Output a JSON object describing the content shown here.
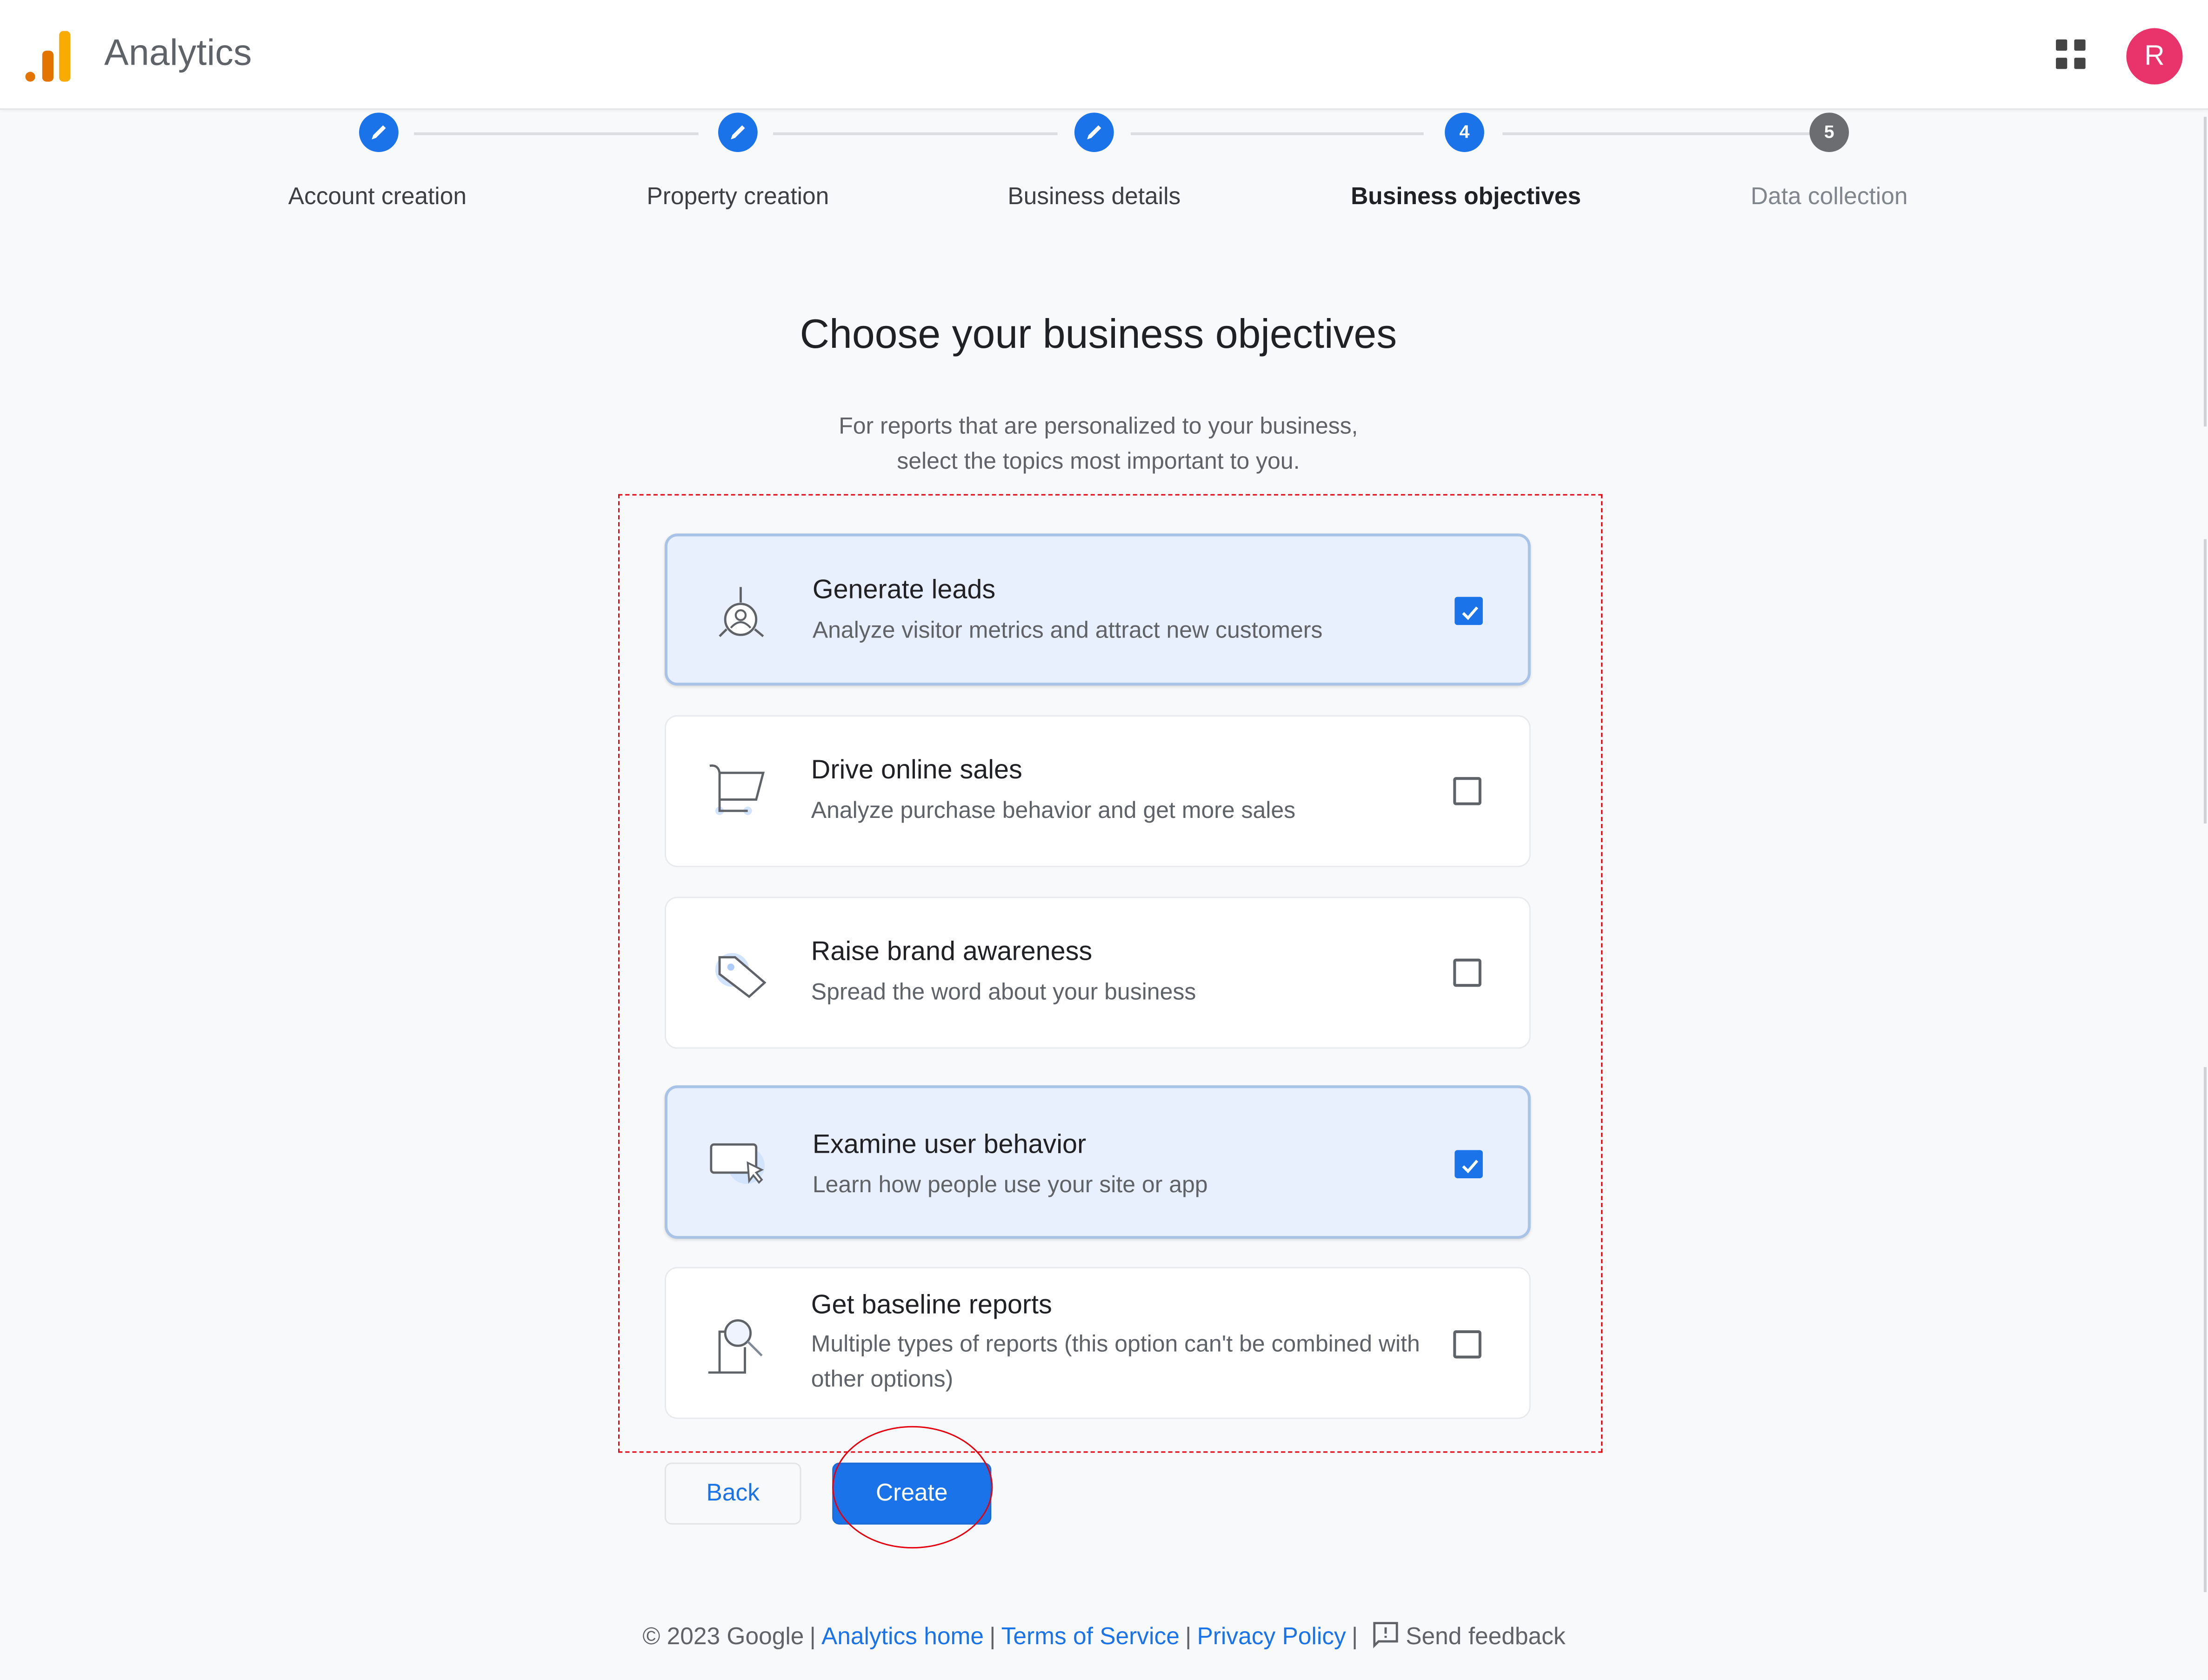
{
  "header": {
    "app_title": "Analytics",
    "logo_icon": "google-analytics-logo",
    "apps_icon": "apps-grid-icon",
    "avatar_initial": "R",
    "avatar_color": "#e8336b"
  },
  "stepper": {
    "steps": [
      {
        "label": "Account creation",
        "state": "completed",
        "marker": ""
      },
      {
        "label": "Property creation",
        "state": "completed",
        "marker": ""
      },
      {
        "label": "Business details",
        "state": "completed",
        "marker": ""
      },
      {
        "label": "Business objectives",
        "state": "active",
        "marker": "4"
      },
      {
        "label": "Data collection",
        "state": "upcoming",
        "marker": "5"
      }
    ]
  },
  "main": {
    "heading": "Choose your business objectives",
    "subtext_line1": "For reports that are personalized to your business,",
    "subtext_line2": "select the topics most important to you.",
    "objectives": [
      {
        "title": "Generate leads",
        "description": "Analyze visitor metrics and attract new customers",
        "icon": "lead-target-icon",
        "checked": true
      },
      {
        "title": "Drive online sales",
        "description": "Analyze purchase behavior and get more sales",
        "icon": "shopping-cart-icon",
        "checked": false
      },
      {
        "title": "Raise brand awareness",
        "description": "Spread the word about your business",
        "icon": "tag-icon",
        "checked": false
      },
      {
        "title": "Examine user behavior",
        "description": "Learn how people use your site or app",
        "icon": "screen-cursor-icon",
        "checked": true
      },
      {
        "title": "Get baseline reports",
        "description": "Multiple types of reports (this option can't be combined with other options)",
        "icon": "report-magnifier-icon",
        "checked": false
      }
    ]
  },
  "actions": {
    "back_label": "Back",
    "create_label": "Create"
  },
  "footer": {
    "copyright": "© 2023 Google",
    "links": [
      "Analytics home",
      "Terms of Service",
      "Privacy Policy"
    ],
    "separator": "|",
    "feedback_label": "Send feedback"
  },
  "colors": {
    "accent": "#1a73e8",
    "selected_card_bg": "#e8f0fe",
    "annotation_red": "#e5000f"
  }
}
